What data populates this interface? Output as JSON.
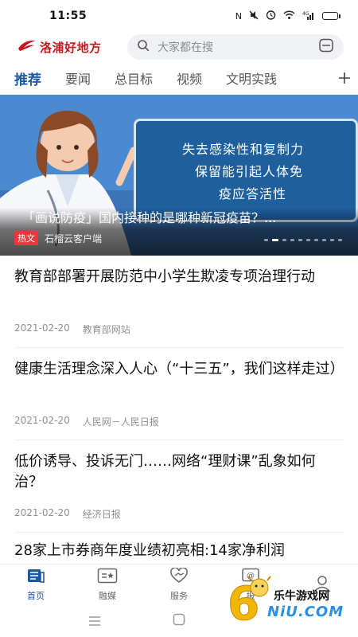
{
  "status_bar": {
    "time": "11:55",
    "signal_label": "4G"
  },
  "header": {
    "logo_text": "洛浦好地方",
    "search_placeholder": "大家都在搜"
  },
  "tabs": [
    {
      "label": "推荐",
      "active": true
    },
    {
      "label": "要闻",
      "active": false
    },
    {
      "label": "总目标",
      "active": false
    },
    {
      "label": "视频",
      "active": false
    },
    {
      "label": "文明实践",
      "active": false
    }
  ],
  "banner": {
    "board_lines": [
      "失去感染性和复制力",
      "保留能引起人体免",
      "疫应答活性"
    ],
    "title": "「画说防疫」国内接种的是哪种新冠疫苗？...",
    "tag": "热文",
    "source": "石榴云客户端"
  },
  "news": [
    {
      "title": "教育部部署开展防范中小学生欺凌专项治理行动",
      "date": "2021-02-20",
      "source": "教育部网站"
    },
    {
      "title": "健康生活理念深入人心（“十三五”，我们这样走过）",
      "date": "2021-02-20",
      "source": "人民网－人民日报"
    },
    {
      "title": "低价诱导、投诉无门……网络“理财课”乱象如何治？",
      "date": "2021-02-20",
      "source": "经济日报"
    },
    {
      "title": "28家上市券商年度业绩初亮相:14家净利润"
    }
  ],
  "bottom_nav": [
    {
      "label": "首页",
      "icon": "home-news-icon",
      "active": true
    },
    {
      "label": "融媒",
      "icon": "media-icon",
      "active": false
    },
    {
      "label": "服务",
      "icon": "service-icon",
      "active": false
    },
    {
      "label": "报",
      "icon": "report-icon",
      "active": false
    },
    {
      "label": "",
      "icon": "profile-icon",
      "active": false
    }
  ],
  "watermark": {
    "text": "乐牛游戏网",
    "sub": "NiU.COM"
  },
  "colors": {
    "accent_blue": "#1d5aa6",
    "logo_red": "#c8161d",
    "hot_tag_red": "#e8383d"
  }
}
